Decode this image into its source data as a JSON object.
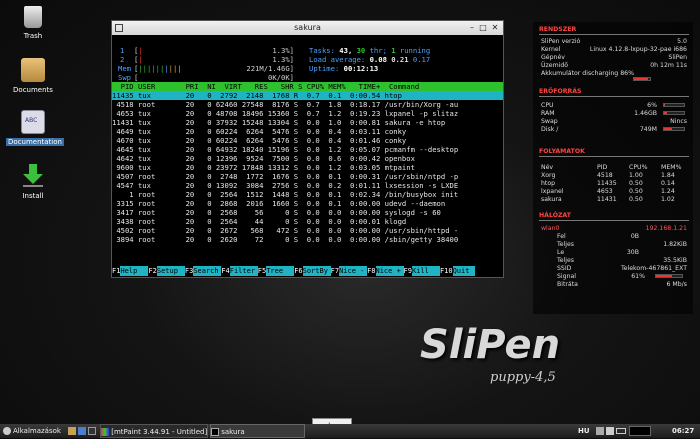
{
  "desktop": {
    "icons": [
      {
        "label": "Trash",
        "icon": "trash-icon"
      },
      {
        "label": "Documents",
        "icon": "folder-icon"
      },
      {
        "label": "Documentation",
        "icon": "book-icon"
      },
      {
        "label": "Install",
        "icon": "install-arrow-icon"
      }
    ]
  },
  "terminal": {
    "title": "sakura",
    "meters": {
      "cpu1_label": "1",
      "cpu1_pct": "1.3%",
      "cpu2_label": "2",
      "cpu2_pct": "1.3%",
      "mem_label": "Mem",
      "mem_val": "221M/1.46G",
      "swp_label": "Swp",
      "swp_val": "0K/0K",
      "tasks_label": "Tasks:",
      "tasks_count": "43,",
      "thr_count": "30",
      "thr_label": "thr;",
      "running_count": "1",
      "running_label": "running",
      "load_label": "Load average:",
      "load1": "0.08",
      "load5": "0.21",
      "load15": "0.17",
      "uptime_label": "Uptime:",
      "uptime": "00:12:13"
    },
    "header": "  PID USER       PRI  NI  VIRT   RES   SHR S CPU% MEM%   TIME+  Command",
    "processes": [
      "11435 tux        20   0  2792  2148  1768 R  0.7  0.1  0:00.54 htop",
      " 4518 root       20   0 62460 27548  8176 S  0.7  1.8  0:18.17 /usr/bin/Xorg -au",
      " 4653 tux        20   0 48708 18496 15360 S  0.7  1.2  0:19.23 lxpanel -p slitaz",
      "11431 tux        20   0 37932 15248 13304 S  0.0  1.0  0:00.81 sakura -e htop",
      " 4649 tux        20   0 60224  6264  5476 S  0.0  0.4  0:03.11 conky",
      " 4670 tux        20   0 60224  6264  5476 S  0.0  0.4  0:01.46 conky",
      " 4645 tux        20   0 64932 18240 15196 S  0.0  1.2  0:05.07 pcmanfm --desktop",
      " 4642 tux        20   0 12396  9524  7500 S  0.0  0.6  0:00.42 openbox",
      " 9600 tux        20   0 23972 17848 13312 S  0.0  1.2  0:03.05 mtpaint",
      " 4507 root       20   0  2748  1772  1676 S  0.0  0.1  0:00.31 /usr/sbin/ntpd -p",
      " 4547 tux        20   0 13092  3084  2756 S  0.0  0.2  0:01.11 lxsession -s LXDE",
      "    1 root       20   0  2564  1512  1448 S  0.0  0.1  0:02.34 /bin/busybox init",
      " 3315 root       20   0  2868  2016  1660 S  0.0  0.1  0:00.00 udevd --daemon",
      " 3417 root       20   0  2568    56     0 S  0.0  0.0  0:00.00 syslogd -s 60",
      " 3438 root       20   0  2564    44     0 S  0.0  0.0  0:00.01 klogd",
      " 4502 root       20   0  2672   568   472 S  0.0  0.0  0:00.00 /usr/sbin/httpd -",
      " 3894 root       20   0  2620    72     0 S  0.0  0.0  0:00.00 /sbin/getty 38400"
    ],
    "fkeys": [
      {
        "key": "F1",
        "label": "Help"
      },
      {
        "key": "F2",
        "label": "Setup"
      },
      {
        "key": "F3",
        "label": "Search"
      },
      {
        "key": "F4",
        "label": "Filter"
      },
      {
        "key": "F5",
        "label": "Tree"
      },
      {
        "key": "F6",
        "label": "SortBy"
      },
      {
        "key": "F7",
        "label": "Nice -"
      },
      {
        "key": "F8",
        "label": "Nice +"
      },
      {
        "key": "F9",
        "label": "Kill"
      },
      {
        "key": "F10",
        "label": "Quit"
      }
    ]
  },
  "conky": {
    "rendszer": {
      "title": "RENDSZER",
      "rows": [
        [
          "SliPen verzió",
          "5.0"
        ],
        [
          "Kernel",
          "Linux 4.12.8-lxpup-32-pae i686"
        ],
        [
          "Gépnév",
          "SliPen"
        ],
        [
          "Üzemidő",
          "0h 12m 11s"
        ],
        [
          "Akkumulátor discharging 86%",
          ""
        ]
      ],
      "battery_pct": 86
    },
    "eroforras": {
      "title": "ERŐFORRÁS",
      "cpu_label": "CPU",
      "cpu_val": "6%",
      "cpu_pct": 6,
      "ram_label": "RAM",
      "ram_val": "1.46GB",
      "ram_pct": 15,
      "swap_label": "Swap",
      "swap_val": "Nincs",
      "disk_label": "Disk /",
      "disk_val": "749M",
      "disk_pct": 40
    },
    "folyamatok": {
      "title": "FOLYAMATOK",
      "headers": [
        "Név",
        "PID",
        "CPU%",
        "MEM%"
      ],
      "rows": [
        [
          "Xorg",
          "4518",
          "1.00",
          "1.84"
        ],
        [
          "htop",
          "11435",
          "0.50",
          "0.14"
        ],
        [
          "lxpanel",
          "4653",
          "0.50",
          "1.24"
        ],
        [
          "sakura",
          "11431",
          "0.50",
          "1.02"
        ]
      ]
    },
    "halozat": {
      "title": "HÁLÓZAT",
      "iface": "wlan0",
      "ip": "192.168.1.21",
      "fel_label": "Fel",
      "fel_val": "0B",
      "teljes1_label": "Teljes",
      "teljes1_val": "1.82KiB",
      "le_label": "Le",
      "le_val": "30B",
      "teljes2_label": "Teljes",
      "teljes2_val": "35.5KiB",
      "ssid_label": "SSID",
      "ssid_val": "Telekom-467861_EXT",
      "signal_label": "Signal",
      "signal_val": "61%",
      "signal_pct": 61,
      "bitrate_label": "Bitráta",
      "bitrate_val": "6 Mb/s"
    }
  },
  "logo": {
    "main": "SliPen",
    "sub": "puppy-4,5"
  },
  "taskbar": {
    "menu_label": "Alkalmazások",
    "task1": "[mtPaint 3.44.91 - Untitled]",
    "task2": "sakura",
    "popup": "sakura",
    "lang": "HU",
    "clock": "06:27"
  },
  "colors": {
    "htop_header": "#2ec12e",
    "htop_selection": "#1fb4c4",
    "conky_section": "#ff4444",
    "ip": "#ff5555"
  }
}
